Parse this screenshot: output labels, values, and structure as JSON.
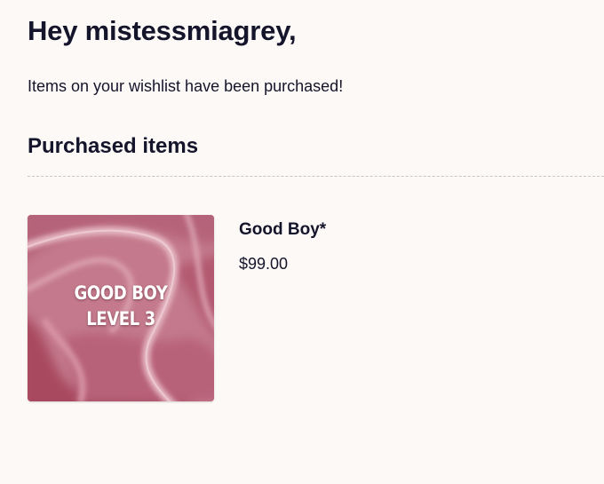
{
  "email": {
    "greeting": "Hey mistessmiagrey,",
    "message": "Items on your wishlist have been purchased!",
    "section_title": "Purchased items"
  },
  "items": [
    {
      "name": "Good Boy*",
      "price": "$99.00",
      "thumbnail_text": [
        "GOOD BOY",
        "LEVEL 3"
      ],
      "thumbnail_colors": {
        "base": "#c47a8c",
        "light": "#e4b4c0",
        "dark": "#a8495f"
      }
    }
  ]
}
